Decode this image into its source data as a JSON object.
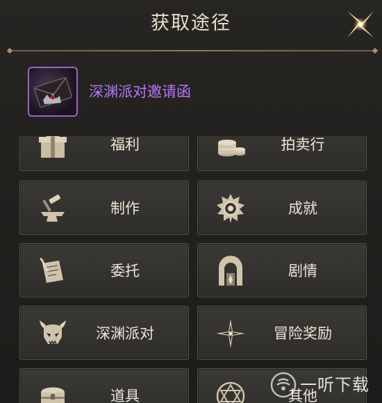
{
  "dialog": {
    "title": "获取途径",
    "close_icon": "close-sparkle-icon"
  },
  "item": {
    "name": "深渊派对邀请函",
    "icon": "invitation-letter-icon",
    "rarity_color": "#9a63c9",
    "name_color": "#b774ff"
  },
  "sources": [
    {
      "label": "福利",
      "icon": "gift-box-icon"
    },
    {
      "label": "拍卖行",
      "icon": "coin-stack-icon"
    },
    {
      "label": "制作",
      "icon": "anvil-hammer-icon"
    },
    {
      "label": "成就",
      "icon": "medal-icon"
    },
    {
      "label": "委托",
      "icon": "scroll-quill-icon"
    },
    {
      "label": "剧情",
      "icon": "arch-gate-icon"
    },
    {
      "label": "深渊派对",
      "icon": "demon-skull-icon"
    },
    {
      "label": "冒险奖励",
      "icon": "compass-star-icon"
    },
    {
      "label": "道具",
      "icon": "treasure-chest-icon"
    },
    {
      "label": "其他",
      "icon": "hexagram-circle-icon"
    }
  ],
  "watermark": {
    "text": "一听下载",
    "logo": "watermark-logo-icon"
  }
}
